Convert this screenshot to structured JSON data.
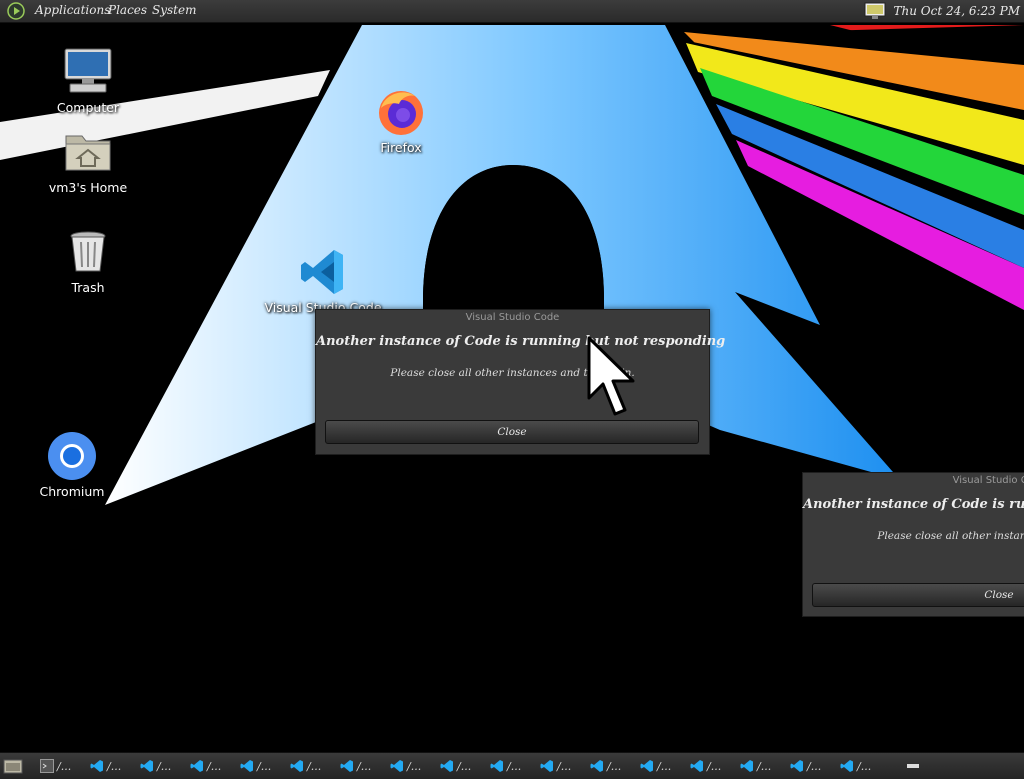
{
  "top_panel": {
    "menus": [
      "Applications",
      "Places",
      "System"
    ],
    "clock": "Thu Oct 24,  6:23 PM"
  },
  "desktop_icons": {
    "computer": "Computer",
    "home": "vm3's Home",
    "trash": "Trash",
    "firefox": "Firefox",
    "vscode": "Visual Studio Code",
    "chromium": "Chromium"
  },
  "dialog_main": {
    "title": "Visual Studio Code",
    "headline": "Another instance of Code is running but not responding",
    "detail": "Please close all other instances and try again.",
    "close_label": "Close"
  },
  "dialog_second": {
    "title": "Visual Studio Code",
    "headline": "Another instance of Code is running but not responding",
    "detail": "Please close all other instances and try again.",
    "close_label": "Close"
  },
  "taskbar": {
    "task_label": "/..."
  },
  "colors": {
    "panel": "#2e2e2e",
    "dialog": "#3a3a3a",
    "arch_blue": "#1793d1",
    "vscode_blue": "#23a9f2"
  }
}
